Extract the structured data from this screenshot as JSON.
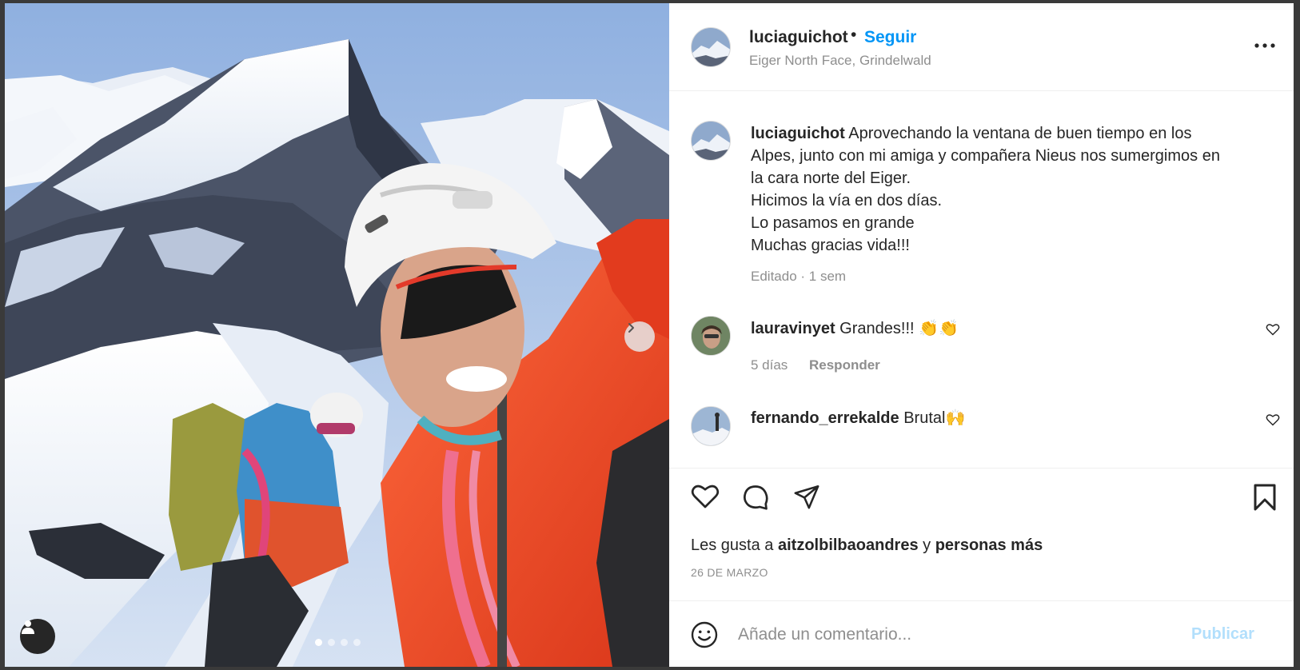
{
  "post": {
    "username": "luciaguichot",
    "separator": "•",
    "follow_label": "Seguir",
    "location": "Eiger North Face, Grindelwald",
    "more_icon": "more-horizontal-icon",
    "caption": {
      "username": "luciaguichot",
      "lines": [
        "Aprovechando la ventana de buen tiempo en los",
        "Alpes, junto con mi amiga y compañera Nieus nos sumergimos en",
        "la cara norte del Eiger.",
        "Hicimos la vía en dos días.",
        "Lo pasamos en grande",
        "Muchas gracias vida!!!"
      ],
      "meta": "Editado · 1 sem"
    },
    "comments": [
      {
        "username": "lauravinyet",
        "text": "Grandes!!! 👏👏",
        "time": "5 días",
        "reply_label": "Responder"
      },
      {
        "username": "fernando_errekalde",
        "text": "Brutal🙌"
      }
    ],
    "likes": {
      "prefix": "Les gusta a",
      "user": "aitzolbilbaoandres",
      "conjunction": "y",
      "others": "personas más"
    },
    "date": "26 DE MARZO",
    "comment_box": {
      "placeholder": "Añade un comentario...",
      "publish_label": "Publicar"
    },
    "carousel": {
      "slide_count": 4,
      "active_index": 0
    }
  },
  "colors": {
    "link_blue": "#0095f6",
    "publish_disabled": "#b2dffc",
    "muted": "#8e8e8e",
    "text": "#262626"
  }
}
